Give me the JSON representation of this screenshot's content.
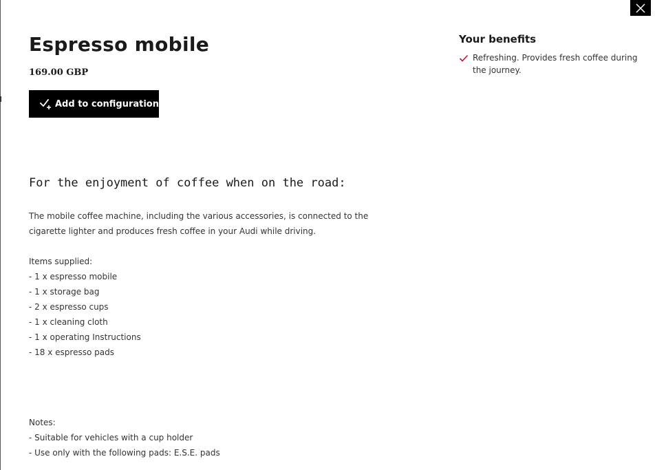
{
  "dialog": {
    "close_icon": "close-icon"
  },
  "product": {
    "title": "Espresso mobile",
    "price": "169.00 GBP",
    "add_button_label": "Add to configuration",
    "add_button_icon": "check-plus-icon"
  },
  "content": {
    "heading": "For the enjoyment of coffee when on the road:",
    "description_lines": [
      "The mobile coffee machine, including the various accessories, is connected to the",
      "cigarette lighter and produces fresh coffee in your Audi while driving."
    ],
    "items_title": "Items supplied:",
    "items": [
      "- 1 x espresso mobile",
      "- 1 x storage bag",
      "- 2 x espresso cups",
      "- 1 x cleaning cloth",
      "- 1 x operating Instructions",
      "- 18 x espresso pads"
    ],
    "notes_title": "Notes:",
    "notes": [
      "- Suitable for vehicles with a cup holder",
      "- Use only with the following pads: E.S.E. pads"
    ]
  },
  "benefits": {
    "title": "Your benefits",
    "items": [
      {
        "icon": "check-icon",
        "text": "Refreshing. Provides fresh coffee during the journey."
      }
    ]
  },
  "colors": {
    "button_bg": "#000000",
    "button_text": "#ffffff",
    "check_accent": "#c8102e",
    "text": "#1a1a1a"
  }
}
